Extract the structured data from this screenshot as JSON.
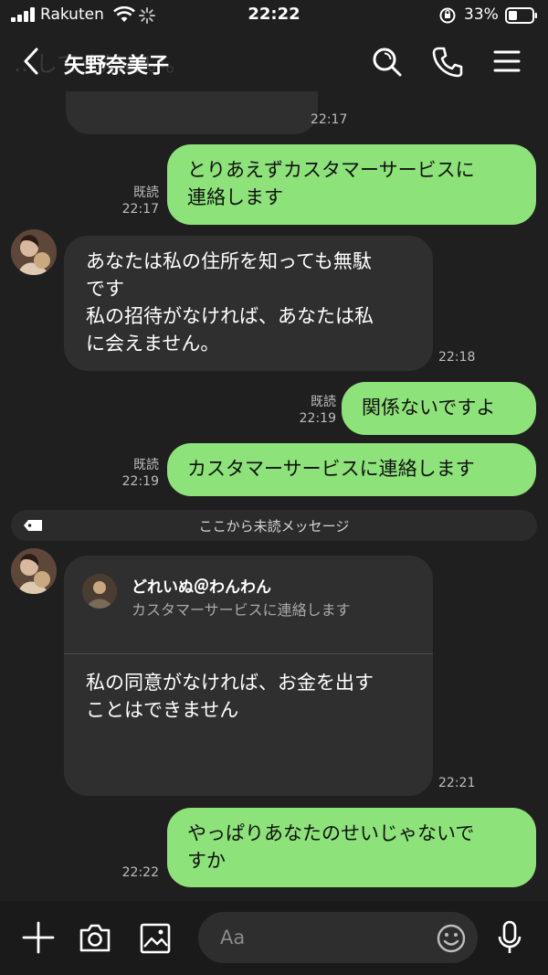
{
  "status_bar": {
    "carrier": "Rakuten",
    "time": "22:22",
    "battery": "33%"
  },
  "header": {
    "title": "矢野奈美子",
    "background_text": "…してください。"
  },
  "messages": [
    {
      "id": "m1",
      "side": "left",
      "time": "22:17"
    },
    {
      "id": "m2",
      "side": "right",
      "read": "既読",
      "time": "22:17",
      "text": "とりあえずカスタマーサービスに\n連絡します"
    },
    {
      "id": "m3",
      "side": "left",
      "time": "22:18",
      "text": "あなたは私の住所を知っても無駄\nです\n私の招待がなければ、あなたは私\nに会えません。"
    },
    {
      "id": "m4",
      "side": "right",
      "read": "既読",
      "time": "22:19",
      "text": "関係ないですよ"
    },
    {
      "id": "m5",
      "side": "right",
      "read": "既読",
      "time": "22:19",
      "text": "カスタマーサービスに連絡します"
    },
    {
      "id": "m6",
      "side": "left",
      "time": "22:21",
      "reply_name": "どれいぬ＠わんわん",
      "reply_text": "カスタマーサービスに連絡します",
      "text": "私の同意がなければ、お金を出す\nことはできません"
    },
    {
      "id": "m7",
      "side": "right",
      "time": "22:22",
      "text": "やっぱりあなたのせいじゃないで\nすか"
    }
  ],
  "unread_divider": "ここから未読メッセージ",
  "input": {
    "placeholder": "Aa"
  },
  "colors": {
    "background": "#1f1f1f",
    "left_bubble": "#2f2f2f",
    "right_bubble": "#8de27a"
  },
  "icons": [
    "back-icon",
    "search-icon",
    "phone-icon",
    "menu-icon",
    "plus-icon",
    "camera-icon",
    "image-icon",
    "emoji-icon",
    "mic-icon",
    "tag-icon"
  ]
}
